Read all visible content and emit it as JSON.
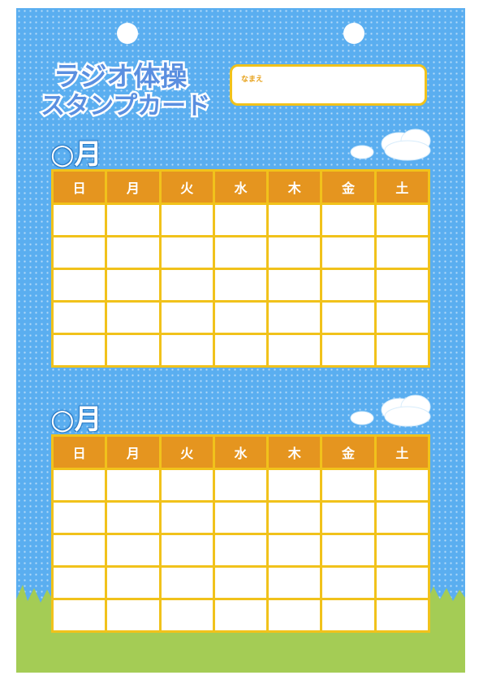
{
  "title": {
    "line1": "ラジオ体操",
    "line2": "スタンプカード"
  },
  "name_field": {
    "label": "なまえ"
  },
  "calendars": [
    {
      "month_label": "○月",
      "weekdays": [
        "日",
        "月",
        "火",
        "水",
        "木",
        "金",
        "土"
      ]
    },
    {
      "month_label": "○月",
      "weekdays": [
        "日",
        "月",
        "火",
        "水",
        "木",
        "金",
        "土"
      ]
    }
  ],
  "colors": {
    "sky": "#5aaef0",
    "header_orange": "#e5951f",
    "grid_yellow": "#f1c21b",
    "grass": "#a4cc55",
    "title_fill": "#5a8fe0"
  }
}
